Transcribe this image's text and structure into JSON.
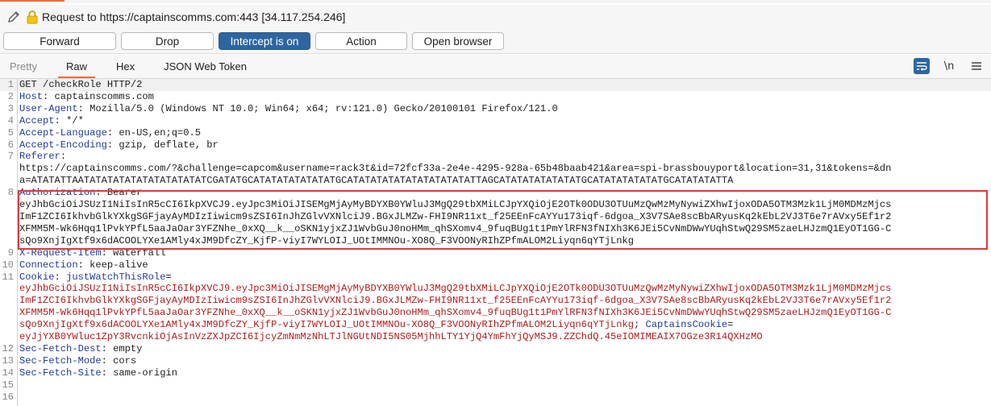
{
  "request": {
    "title": "Request to https://captainscomms.com:443  [34.117.254.246]",
    "icons": [
      "pencil-icon",
      "lock-icon"
    ]
  },
  "buttons": {
    "forward": "Forward",
    "drop": "Drop",
    "intercept": "Intercept is on",
    "action": "Action",
    "open_browser": "Open browser"
  },
  "tabs": [
    {
      "label": "Pretty",
      "active": false
    },
    {
      "label": "Raw",
      "active": true
    },
    {
      "label": "Hex",
      "active": false
    },
    {
      "label": "JSON Web Token",
      "active": false
    }
  ],
  "tools": {
    "wrap_icon": "word-wrap-icon",
    "newline_label": "\\n",
    "menu_icon": "hamburger-menu-icon"
  },
  "editor": {
    "line_numbers": [
      "1",
      "2",
      "3",
      "4",
      "5",
      "6",
      "7",
      "",
      "",
      "8",
      "",
      "",
      "",
      "",
      "9",
      "10",
      "11",
      "",
      "",
      "",
      "",
      "",
      "12",
      "13",
      "14",
      "15",
      "16"
    ],
    "lines": {
      "l1": "GET /checkRole HTTP/2",
      "l2_key": "Host",
      "l2_val": " captainscomms.com",
      "l3_key": "User-Agent",
      "l3_val": " Mozilla/5.0 (Windows NT 10.0; Win64; x64; rv:121.0) Gecko/20100101 Firefox/121.0",
      "l4_key": "Accept",
      "l4_val": " */*",
      "l5_key": "Accept-Language",
      "l5_val": " en-US,en;q=0.5",
      "l6_key": "Accept-Encoding",
      "l6_val": " gzip, deflate, br",
      "l7_key": "Referer",
      "l7_val": "",
      "l7_w1": "https://captainscomms.com/?&challenge=capcom&username=rack3t&id=72fcf33a-2e4e-4295-928a-65b48baab421&area=spi-brassbouyport&location=31,31&tokens=&dn",
      "l7_w2": "a=ATATATTAATATATATATATATATATATATCGATATGCATATATATATATATGCATATATATATATATATATATATTAGCATATATATATATATGCATATATATATATGCATATATATTA",
      "l8_key": "Authorization",
      "l8_val": " Bearer",
      "l8_w1": "eyJhbGciOiJSUzI1NiIsInR5cCI6IkpXVCJ9.eyJpc3MiOiJISEMgMjAyMyBDYXB0YWluJ3MgQ29tbXMiLCJpYXQiOjE2OTk0ODU3OTUuMzQwMzMyNywiZXhwIjoxODA5OTM3Mzk1LjM0MDMzMjcs",
      "l8_w2": "ImF1ZCI6IkhvbGlkYXkgSGFjayAyMDIzIiwicm9sZSI6InJhZGlvVXNlciJ9.BGxJLMZw-FHI9NR11xt_f25EEnFcAYYu173iqf-6dgoa_X3V7SAe8scBbARyusKq2kEbL2VJ3T6e7rAVxy5Ef1r2",
      "l8_w3": "XFMM5M-Wk6Hqq1lPvkYPfL5aaJaOar3YFZNhe_0xXQ__k__oSKN1yjxZJ1WvbGuJ0noHMm_qhSXomv4_9fuqBUg1t1PmYlRFN3fNIXh3K6JEi5CvNmDWwYUqhStwQ29SM5zaeLHJzmQ1EyOT1GG-C",
      "l8_w4": "sQo9XnjIgXtf9x6dACOOLYXe1AMly4xJM9DfcZY_KjfP-viyI7WYLOIJ_UOtIMMNOu-XO8Q_F3VOONyRIhZPfmALOM2Liyqn6qYTjLnkg",
      "l9_key": "X-Request-Item",
      "l9_val": " waterfall",
      "l10_key": "Connection",
      "l10_val": " keep-alive",
      "l11_key": "Cookie",
      "l11_name1": " justWatchThisRole",
      "l11_eq": "=",
      "l11_w1": "eyJhbGciOiJSUzI1NiIsInR5cCI6IkpXVCJ9.eyJpc3MiOiJISEMgMjAyMyBDYXB0YWluJ3MgQ29tbXMiLCJpYXQiOjE2OTk0ODU3OTUuMzQwMzMyNywiZXhwIjoxODA5OTM3Mzk1LjM0MDMzMjcs",
      "l11_w2": "ImF1ZCI6IkhvbGlkYXkgSGFjayAyMDIzIiwicm9sZSI6InJhZGlvVXNlciJ9.BGxJLMZw-FHI9NR11xt_f25EEnFcAYYu173iqf-6dgoa_X3V7SAe8scBbARyusKq2kEbL2VJ3T6e7rAVxy5Ef1r2",
      "l11_w3": "XFMM5M-Wk6Hqq1lPvkYPfL5aaJaOar3YFZNhe_0xXQ__k__oSKN1yjxZJ1WvbGuJ0noHMm_qhSXomv4_9fuqBUg1t1PmYlRFN3fNIXh3K6JEi5CvNmDWwYUqhStwQ29SM5zaeLHJzmQ1EyOT1GG-C",
      "l11_w4a": "sQo9XnjIgXtf9x6dACOOLYXe1AMly4xJM9DfcZY_KjfP-viyI7WYLOIJ_UOtIMMNOu-XO8Q_F3VOONyRIhZPfmALOM2Liyqn6qYTjLnkg",
      "l11_sep": "; ",
      "l11_name2": "CaptainsCookie",
      "l11_eq2": "=",
      "l11_w5": "eyJjYXB0YWluc1ZpY3RvcnkiOjAsInVzZXJpZCI6IjcyZmNmMzNhLTJlNGUtNDI5NS05MjhhLTY1YjQ4YmFhYjQyMSJ9.ZZChdQ.45eIOMIMEAIX7OGze3R14QXHzMO",
      "l12_key": "Sec-Fetch-Dest",
      "l12_val": " empty",
      "l13_key": "Sec-Fetch-Mode",
      "l13_val": " cors",
      "l14_key": "Sec-Fetch-Site",
      "l14_val": " same-origin"
    }
  },
  "colors": {
    "accent_orange": "#f26b3a",
    "primary_blue": "#2d669f",
    "header_key_blue": "#1f3b9a",
    "cookie_red": "#b21b1b",
    "highlight_red": "#e0393e"
  }
}
